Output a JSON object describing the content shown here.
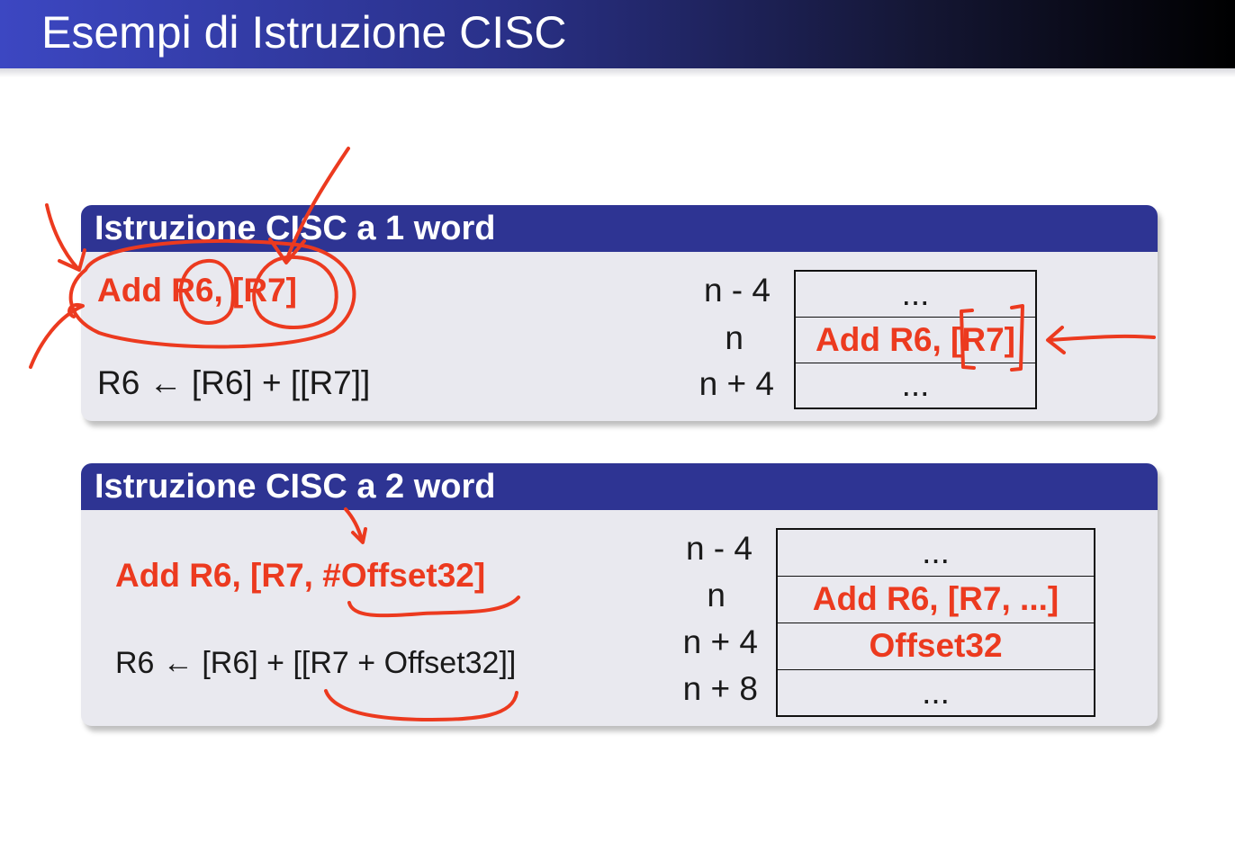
{
  "slide": {
    "title": "Esempi di Istruzione CISC"
  },
  "block1": {
    "header": "Istruzione CISC a 1 word",
    "instruction": "Add R6, [R7]",
    "semantics": "R6 ← [R6] + [[R7]]",
    "addresses": [
      "n - 4",
      "n",
      "n + 4"
    ],
    "memory": [
      "...",
      "Add R6, [R7]",
      "..."
    ]
  },
  "block2": {
    "header": "Istruzione CISC a 2 word",
    "instruction": "Add R6, [R7, #Offset32]",
    "semantics": "R6 ← [R6] + [[R7 + Offset32]]",
    "addresses": [
      "n - 4",
      "n",
      "n + 4",
      "n + 8"
    ],
    "memory": [
      "...",
      "Add R6, [R7, ...]",
      "Offset32",
      "..."
    ]
  },
  "colors": {
    "accent_red": "#ec3a1f",
    "block_header": "#2e3493",
    "block_body": "#e9e9ef",
    "ink": "#ec3a1f"
  }
}
